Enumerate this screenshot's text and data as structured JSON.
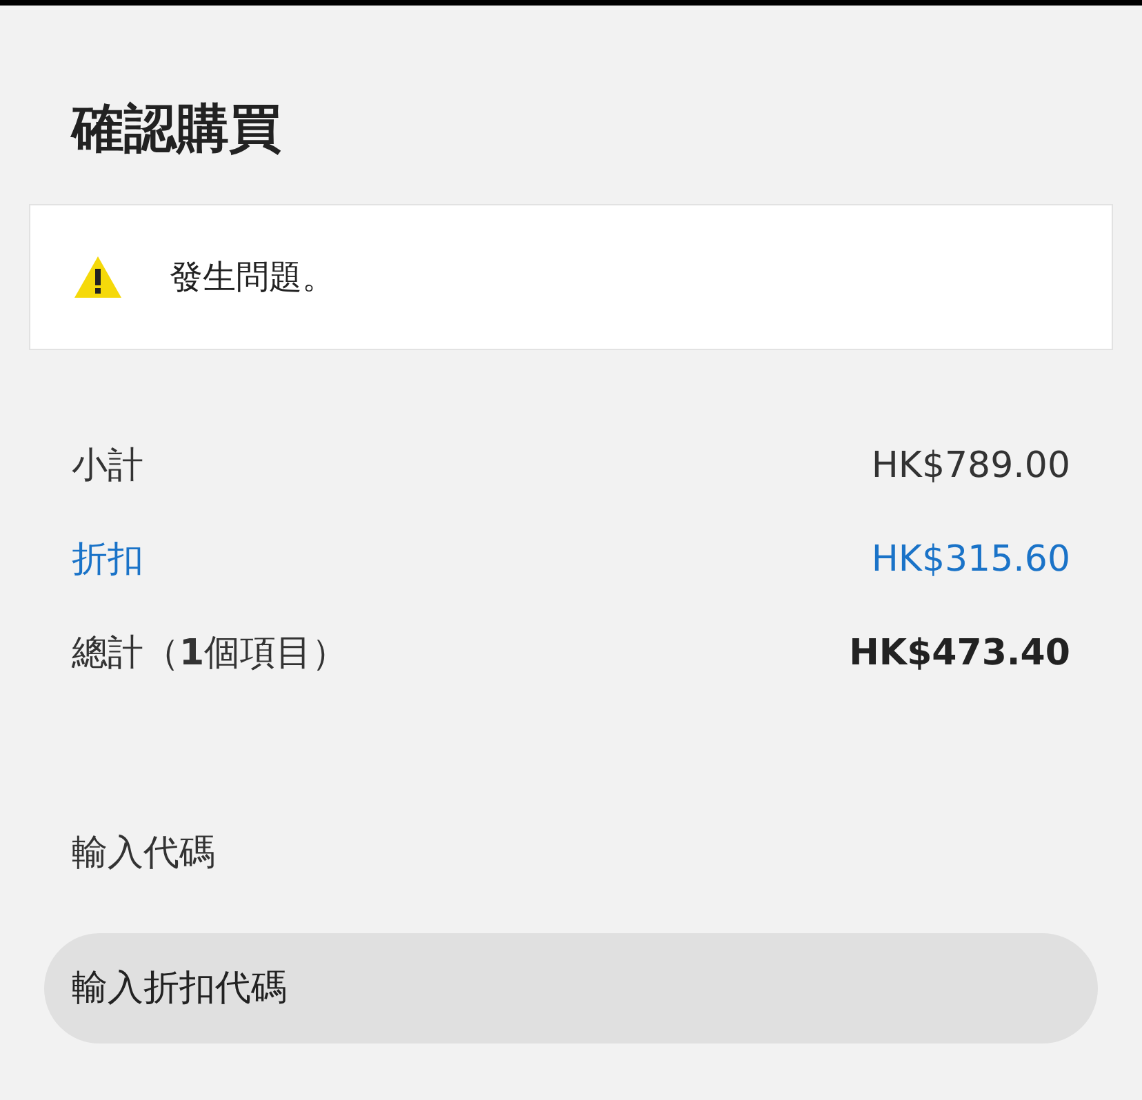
{
  "title": "確認購買",
  "alert": {
    "message": "發生問題。"
  },
  "summary": [
    {
      "kind": "normal",
      "label": "小計",
      "value": "HK$789.00"
    },
    {
      "kind": "discount",
      "label": "折扣",
      "value": "HK$315.60"
    },
    {
      "kind": "total",
      "label": "總計（**1**個項目）",
      "value": "HK$473.40"
    }
  ],
  "code": {
    "label": "輸入代碼",
    "placeholder": "輸入折扣代碼"
  }
}
